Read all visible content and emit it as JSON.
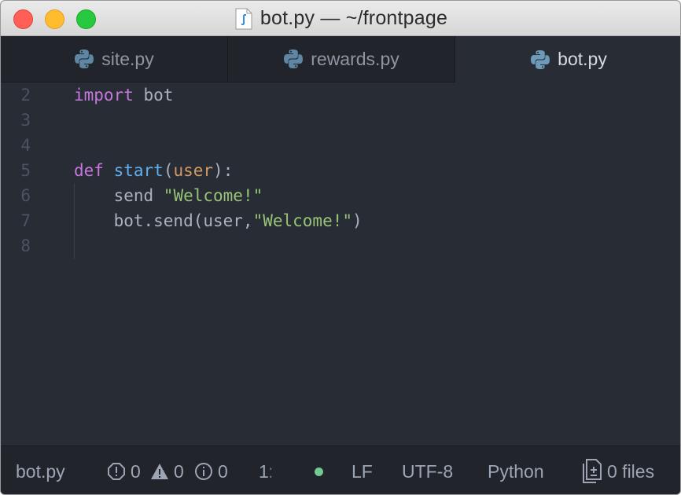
{
  "window": {
    "title": "bot.py — ~/frontpage"
  },
  "tabs": [
    {
      "label": "site.py",
      "active": false
    },
    {
      "label": "rewards.py",
      "active": false
    },
    {
      "label": "bot.py",
      "active": true
    }
  ],
  "editor": {
    "lines": [
      {
        "number": "2",
        "tokens": [
          {
            "text": "import",
            "type": "kw"
          },
          {
            "text": " bot",
            "type": "plain"
          }
        ]
      },
      {
        "number": "3",
        "tokens": []
      },
      {
        "number": "4",
        "tokens": []
      },
      {
        "number": "5",
        "tokens": [
          {
            "text": "def",
            "type": "kw"
          },
          {
            "text": " ",
            "type": "plain"
          },
          {
            "text": "start",
            "type": "fn"
          },
          {
            "text": "(",
            "type": "plain"
          },
          {
            "text": "user",
            "type": "param"
          },
          {
            "text": "):",
            "type": "plain"
          }
        ]
      },
      {
        "number": "6",
        "tokens": [
          {
            "text": "    send ",
            "type": "plain"
          },
          {
            "text": "\"Welcome!\"",
            "type": "str"
          }
        ]
      },
      {
        "number": "7",
        "tokens": [
          {
            "text": "    bot.send(user,",
            "type": "plain"
          },
          {
            "text": "\"Welcome!\"",
            "type": "str"
          },
          {
            "text": ")",
            "type": "plain"
          }
        ]
      },
      {
        "number": "8",
        "tokens": []
      }
    ]
  },
  "statusbar": {
    "file": "bot.py",
    "errors": "0",
    "warnings": "0",
    "infos": "0",
    "cursor": "1:",
    "line_ending": "LF",
    "encoding": "UTF-8",
    "grammar": "Python",
    "git_files": "0 files"
  },
  "colors": {
    "keyword": "#c678dd",
    "function": "#61afef",
    "parameter": "#d19a66",
    "string": "#98c379",
    "text": "#abb2bf",
    "status_dot": "#73c990"
  }
}
